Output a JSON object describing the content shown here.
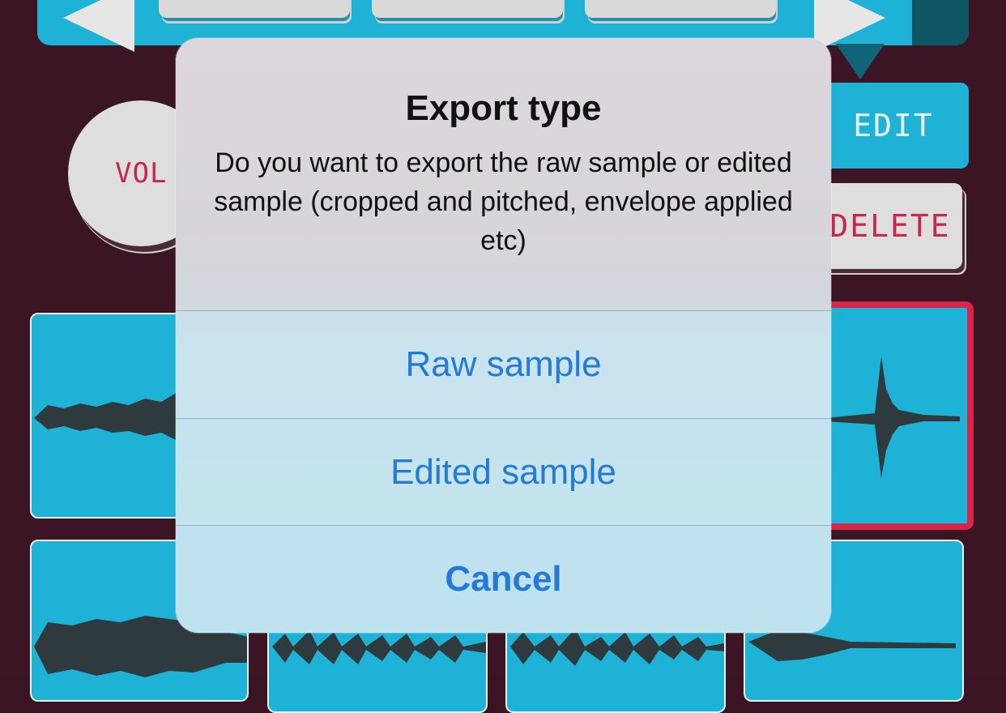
{
  "background": {
    "vol_label": "VOL",
    "edit_label": "EDIT",
    "delete_label": "DELETE"
  },
  "dialog": {
    "title": "Export type",
    "message": "Do you want to export the raw sample or edited sample (cropped and pitched, envelope applied etc)",
    "buttons": {
      "raw": "Raw sample",
      "edited": "Edited sample",
      "cancel": "Cancel"
    }
  },
  "colors": {
    "accent": "#1eb3d6",
    "background": "#3b1524",
    "selected": "#d6264a",
    "button_text": "#2479d9"
  }
}
